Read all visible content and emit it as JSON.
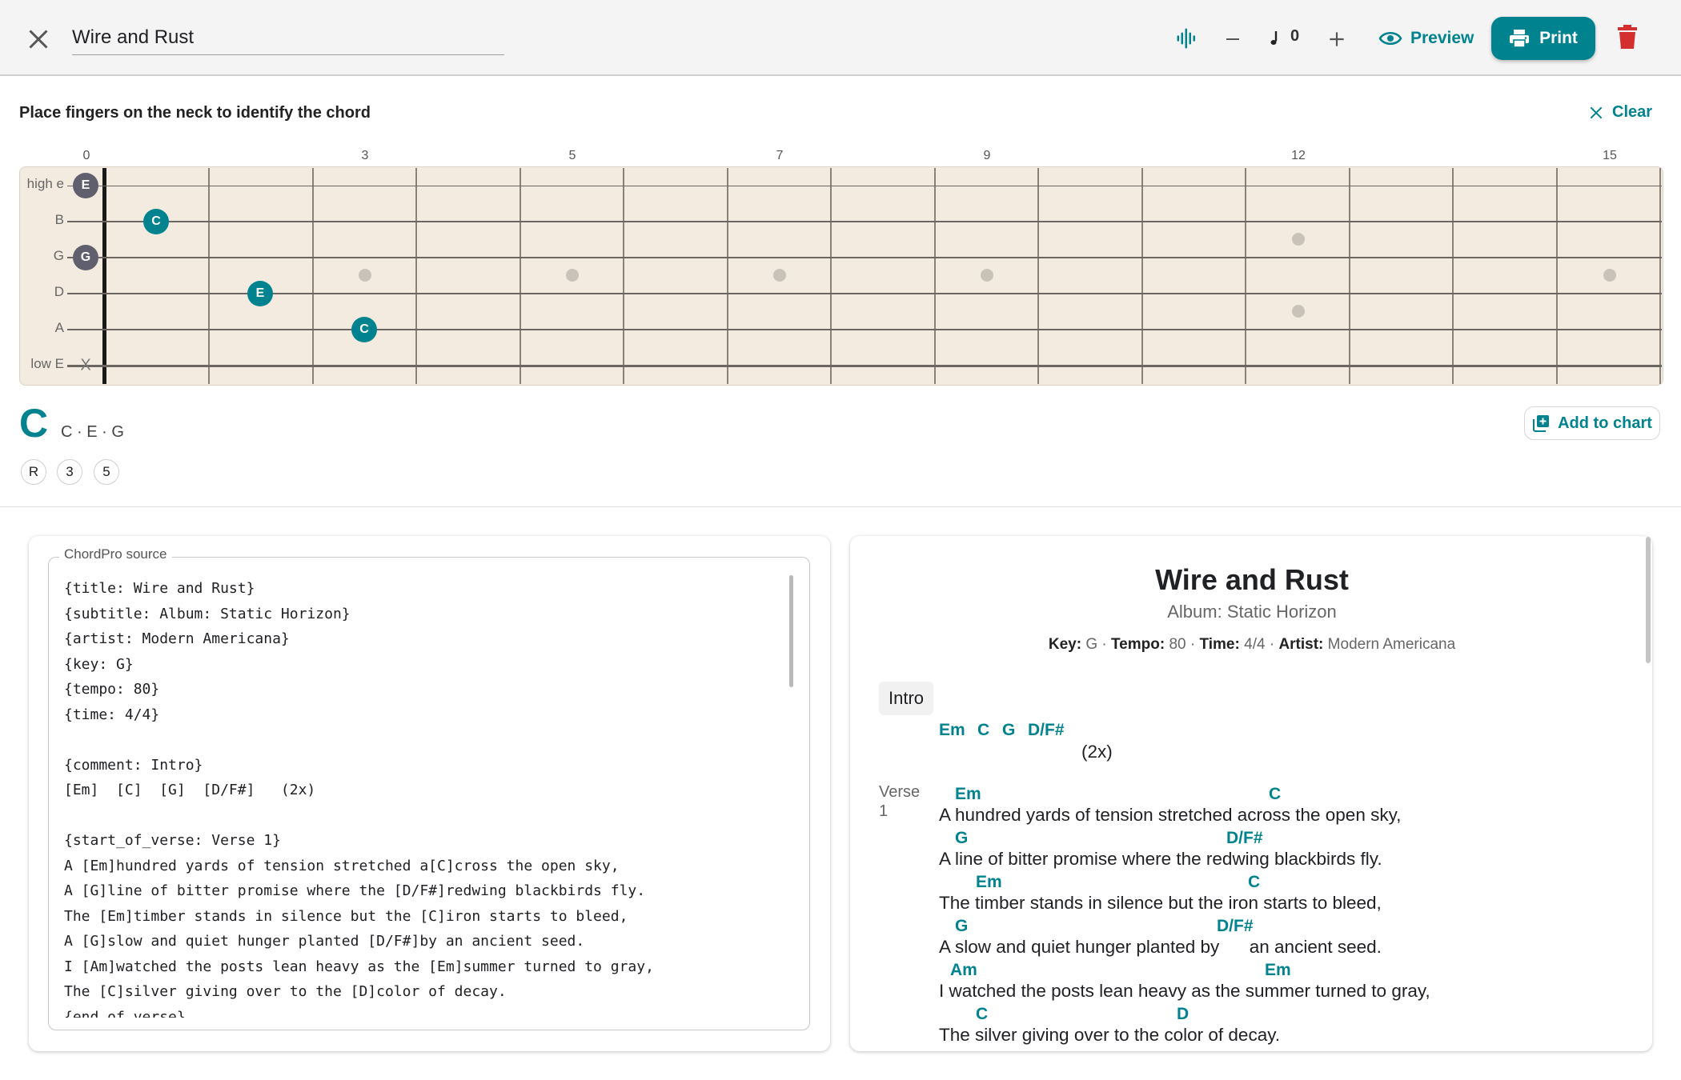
{
  "topbar": {
    "title_value": "Wire and Rust",
    "transpose_value": "0",
    "preview_label": "Preview",
    "print_label": "Print",
    "icons": [
      "close-icon",
      "waveform-icon",
      "minus-icon",
      "music-note-icon",
      "plus-icon",
      "eye-icon",
      "printer-icon",
      "trash-icon"
    ],
    "colors": {
      "accent": "#00838f",
      "danger": "#d32f2f",
      "bar_bg": "#f4f4f4"
    }
  },
  "finder": {
    "instruction": "Place fingers on the neck to identify the chord",
    "clear_label": "Clear",
    "fret_numbers": [
      "0",
      "3",
      "5",
      "7",
      "9",
      "12",
      "15"
    ],
    "strings": [
      "high e",
      "B",
      "G",
      "D",
      "A",
      "low E"
    ],
    "markers": [
      {
        "string": "high e",
        "fret": 0,
        "note": "E"
      },
      {
        "string": "B",
        "fret": 1,
        "note": "C"
      },
      {
        "string": "G",
        "fret": 0,
        "note": "G"
      },
      {
        "string": "D",
        "fret": 2,
        "note": "E"
      },
      {
        "string": "A",
        "fret": 3,
        "note": "C"
      },
      {
        "string": "low E",
        "muted": true,
        "symbol": "X"
      }
    ],
    "neck_color": "#f3ebdf"
  },
  "result": {
    "chord_name": "C",
    "notes": "C · E · G",
    "degrees": [
      "R",
      "3",
      "5"
    ],
    "add_label": "Add to chart"
  },
  "editor": {
    "legend": "ChordPro source",
    "source": "{title: Wire and Rust}\n{subtitle: Album: Static Horizon}\n{artist: Modern Americana}\n{key: G}\n{tempo: 80}\n{time: 4/4}\n\n{comment: Intro}\n[Em]  [C]  [G]  [D/F#]   (2x)\n\n{start_of_verse: Verse 1}\nA [Em]hundred yards of tension stretched a[C]cross the open sky,\nA [G]line of bitter promise where the [D/F#]redwing blackbirds fly.\nThe [Em]timber stands in silence but the [C]iron starts to bleed,\nA [G]slow and quiet hunger planted [D/F#]by an ancient seed.\nI [Am]watched the posts lean heavy as the [Em]summer turned to gray,\nThe [C]silver giving over to the [D]color of decay.\n{end_of_verse}"
  },
  "preview": {
    "title": "Wire and Rust",
    "subtitle": "Album: Static Horizon",
    "meta": {
      "key_label": "Key:",
      "key": "G",
      "tempo_label": "Tempo:",
      "tempo": "80",
      "time_label": "Time:",
      "time": "4/4",
      "artist_label": "Artist:",
      "artist": "Modern Americana",
      "sep": "·"
    },
    "intro_label": "Intro",
    "intro_chords": [
      "Em",
      "C",
      "G",
      "D/F#"
    ],
    "intro_repeat": "(2x)",
    "verse_label": "Verse",
    "verse_number": "1",
    "lines": [
      {
        "chords": [
          "Em",
          "C"
        ],
        "lyric": "A hundred yards of tension stretched across the open sky,"
      },
      {
        "chords": [
          "G",
          "D/F#"
        ],
        "lyric": "A line of bitter promise where the redwing blackbirds fly."
      },
      {
        "chords": [
          "Em",
          "C"
        ],
        "lyric": "The timber stands in silence but the iron starts to bleed,"
      },
      {
        "chords": [
          "G",
          "D/F#"
        ],
        "lyric": "A slow and quiet hunger planted by      an ancient seed."
      },
      {
        "chords": [
          "Am",
          "Em"
        ],
        "lyric": "I watched the posts lean heavy as the summer turned to gray,"
      },
      {
        "chords": [
          "C",
          "D"
        ],
        "lyric": "The silver giving over to the color of decay."
      }
    ]
  }
}
